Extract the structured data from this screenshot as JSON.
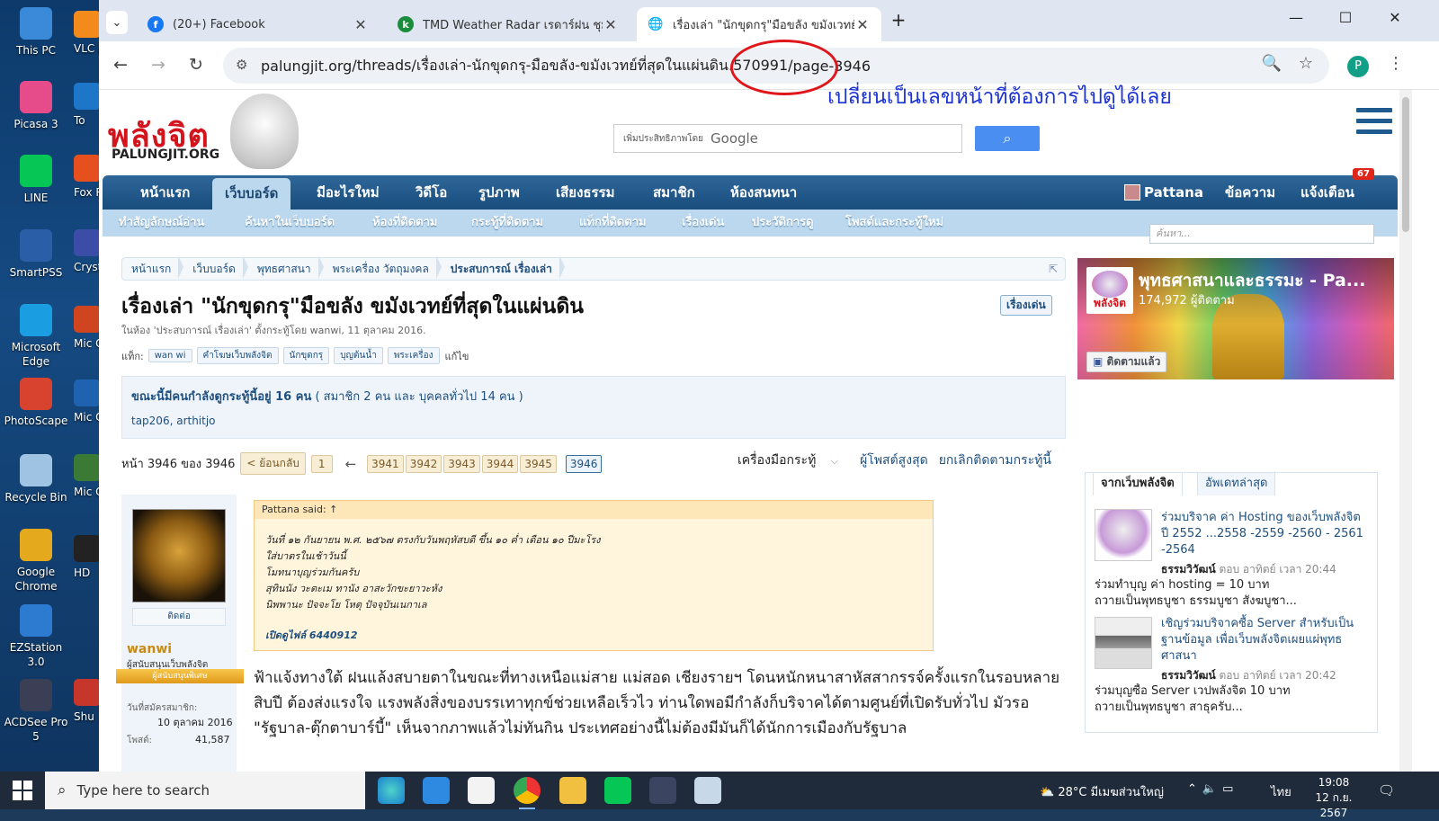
{
  "desktop": {
    "icons": [
      {
        "label": "This PC",
        "color": "#3b8ad9"
      },
      {
        "label": "Picasa 3",
        "color": "#e64b8a"
      },
      {
        "label": "LINE",
        "color": "#06c755"
      },
      {
        "label": "SmartPSS",
        "color": "#2a5fa8"
      },
      {
        "label": "Microsoft Edge",
        "color": "#1b9de2"
      },
      {
        "label": "PhotoScape",
        "color": "#d8432f"
      },
      {
        "label": "Recycle Bin",
        "color": "#9fc3e3"
      },
      {
        "label": "Google Chrome",
        "color": "#e5a91d"
      },
      {
        "label": "EZStation 3.0",
        "color": "#2d7bd1"
      },
      {
        "label": "ACDSee Pro 5",
        "color": "#3a3f55"
      }
    ],
    "icons_col2": [
      {
        "label": "VLC p",
        "color": "#f28a1c"
      },
      {
        "label": "To",
        "color": "#1d76c7"
      },
      {
        "label": "Fox Re",
        "color": "#e6501e"
      },
      {
        "label": "Cryst",
        "color": "#3b4da6"
      },
      {
        "label": "Mic Offic",
        "color": "#cf4520"
      },
      {
        "label": "Mic Offic",
        "color": "#1e62b0"
      },
      {
        "label": "Mic Offic",
        "color": "#3a7a34"
      },
      {
        "label": "HD",
        "color": "#222222"
      },
      {
        "label": "Shu",
        "color": "#c7362b"
      }
    ]
  },
  "browser": {
    "tabs": [
      {
        "title": "(20+) Facebook",
        "favicon": "f",
        "favicon_color": "#1877f2"
      },
      {
        "title": "TMD Weather Radar เรดาร์ฝน ชุมพร",
        "favicon": "k",
        "favicon_color": "#1a8d3c"
      },
      {
        "title": "เรื่องเล่า \"นักขุดกรุ\"มือขลัง ขมังเวทย์ที่สุ",
        "favicon": "🌐",
        "favicon_color": "#555555"
      }
    ],
    "new_tab": "+",
    "url_host": "palungjit.org",
    "url_path": "/threads/เรื่องเล่า-นักขุดกรุ-มือขลัง-ขมังเวทย์ที่สุดในแผ่นดิน.570991/",
    "url_page": "page-3946",
    "profile_initial": "P"
  },
  "annotation": {
    "text": "เปลี่ยนเป็นเลขหน้าที่ต้องการไปดูได้เลย",
    "color": "#1c33d4",
    "circle_color": "#e0161a"
  },
  "site": {
    "logo": "พลังจิต",
    "logo_sub": "PALUNGJIT.ORG",
    "search_powered": "เพิ่มประสิทธิภาพโดย",
    "search_brand": "Google",
    "nav": [
      "หน้าแรก",
      "เว็บบอร์ด",
      "มีอะไรใหม่",
      "วิดีโอ",
      "รูปภาพ",
      "เสียงธรรม",
      "สมาชิก",
      "ห้องสนทนา"
    ],
    "nav_selected": 1,
    "user_nav": {
      "username": "Pattana",
      "messages": "ข้อความ",
      "alerts": "แจ้งเตือน",
      "alerts_badge": "67"
    },
    "subnav": [
      "ทำสัญลักษณ์อ่าน",
      "ค้นหาในเว็บบอร์ด",
      "ห้องที่ติดตาม",
      "กระทู้ที่ติดตาม",
      "แท็กที่ติดตาม",
      "เรื่องเด่น",
      "ประวัติการดู",
      "โพสต์และกระทู้ใหม่"
    ],
    "site_search_placeholder": "ค้นหา..."
  },
  "breadcrumb": [
    "หน้าแรก",
    "เว็บบอร์ด",
    "พุทธศาสนา",
    "พระเครื่อง วัตถุมงคล",
    "ประสบการณ์ เรื่องเล่า"
  ],
  "thread": {
    "title": "เรื่องเล่า \"นักขุดกรุ\"มือขลัง ขมังเวทย์ที่สุดในแผ่นดิน",
    "featured_badge": "เรื่องเด่น",
    "meta": "ในห้อง 'ประสบการณ์ เรื่องเล่า' ตั้งกระทู้โดย wanwi, 11 ตุลาคม 2016.",
    "tags_label": "แท็ก:",
    "tags": [
      "wan wi",
      "คำโฆษเว็บพลังจิต",
      "นักขุดกรุ",
      "บุญต้นน้ำ",
      "พระเครื่อง"
    ],
    "tags_edit": "แก้ไข",
    "viewers_bold": "ขณะนี้มีคนกำลังดูกระทู้นี้อยู่ 16 คน",
    "viewers_rest": " ( สมาชิก 2 คน และ บุคคลทั่วไป 14 คน )",
    "viewers_names": "tap206, arthitjo",
    "pager_label": "หน้า 3946 ของ 3946",
    "pager_prev": "< ย้อนกลับ",
    "pager_first": "1",
    "pager_ellipsis": "←",
    "pager_pages": [
      "3941",
      "3942",
      "3943",
      "3944",
      "3945",
      "3946"
    ],
    "tools": "เครื่องมือกระทู้",
    "top_posters": "ผู้โพสต์สูงสุด",
    "unwatch": "ยกเลิกติดตามกระทู้นี้"
  },
  "post": {
    "follow": "ติดต่อ",
    "username": "wanwi",
    "user_title": "ผู้สนับสนุนเว็บพลังจิต",
    "user_banner": "ผู้สนับสนุนพิเศษ",
    "joined_label": "วันที่สมัครสมาชิก:",
    "joined_value": "10 ตุลาคม 2016",
    "posts_label": "โพสต์:",
    "posts_value": "41,587",
    "quote_head": "Pattana said: ↑",
    "quote_lines": [
      "วันที่ ๑๒ กันยายน พ.ศ. ๒๕๖๗ ตรงกับวันพฤหัสบดี ขึ้น ๑๐ ค่ำ เดือน ๑๐ ปีมะโรง",
      "ใส่บาตรในเช้าวันนี้",
      "โมทนาบุญร่วมกันครับ",
      "สุทินนัง วะตะเม ทานัง อาสะวักขะยาวะหัง",
      "นิพพานะ ปัจจะโย โหตุ ปัจจุบันเนกาเล",
      "",
      "เปิดดูไฟล์ 6440912"
    ],
    "body": "ฟ้าแจ้งทางใต้ ฝนแล้งสบายตาในขณะที่ทางเหนือแม่สาย แม่สอด เชียงรายฯ โดนหนักหนาสาหัสสากรรจ์ครั้งแรกในรอบหลายสิบปี ต้องส่งแรงใจ แรงพลังสิ่งของบรรเทาทุกข์ช่วยเหลือเร็วไว ท่านใดพอมีกำลังก็บริจาคได้ตามศูนย์ที่เปิดรับทั่วไป มัวรอ \"รัฐบาล-ตุ๊กตาบาร์บี้\" เห็นจากภาพแล้วไม่ทันกิน ประเทศอย่างนี้ไม่ต้องมีมันก็ได้นักการเมืองกับรัฐบาล"
  },
  "sidebar": {
    "fb_name": "พุทธศาสนาและธรรมะ - Pa...",
    "fb_followers": "174,972 ผู้ติดตาม",
    "fb_follow": "ติดตามแล้ว",
    "fb_avatar_label": "พลังจิต",
    "tabs": [
      "จากเว็บพลังจิต",
      "อัพเดทล่าสุด"
    ],
    "items": [
      {
        "title": "ร่วมบริจาค ค่า Hosting ของเว็บพลังจิต ปี 2552 ...2558 -2559 -2560 - 2561 -2564",
        "author": "ธรรมวิวัฒน์",
        "time": " ตอบ อาทิตย์ เวลา 20:44",
        "snippet1": "ร่วมทำบุญ ค่า hosting = 10 บาท",
        "snippet2": "ถวายเป็นพุทธบูชา ธรรมบูชา สังฆบูชา..."
      },
      {
        "title": "เชิญร่วมบริจาคซื้อ Server สำหรับเป็นฐานข้อมูล เพื่อเว็บพลังจิตเผยแผ่พุทธศาสนา",
        "author": "ธรรมวิวัฒน์",
        "time": " ตอบ อาทิตย์ เวลา 20:42",
        "snippet1": "ร่วมบุญซื้อ Server เวปพลังจิต 10 บาท",
        "snippet2": "ถวายเป็นพุทธบูชา สาธุครับ..."
      }
    ]
  },
  "taskbar": {
    "search_placeholder": "Type here to search",
    "weather": "28°C  มีเมฆส่วนใหญ่",
    "lang": "ไทย",
    "time": "19:08",
    "date": "12 ก.ย. 2567"
  }
}
